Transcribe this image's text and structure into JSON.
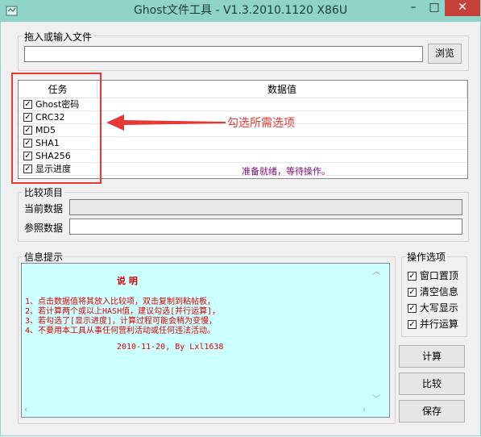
{
  "window": {
    "title": "Ghost文件工具 - V1.3.2010.1120 X86U",
    "min": "–",
    "max": "□",
    "close": "✕"
  },
  "file_input": {
    "label": "拖入或输入文件",
    "value": "",
    "browse_label": "浏览"
  },
  "task_table": {
    "col_task": "任务",
    "col_value": "数据值",
    "rows": [
      {
        "label": "Ghost密码",
        "checked": true
      },
      {
        "label": "CRC32",
        "checked": true
      },
      {
        "label": "MD5",
        "checked": true
      },
      {
        "label": "SHA1",
        "checked": true
      },
      {
        "label": "SHA256",
        "checked": true
      },
      {
        "label": "显示进度",
        "checked": true
      }
    ],
    "status": "准备就绪，等待操作。"
  },
  "annotation": "勾选所需选项",
  "compare": {
    "legend": "比较项目",
    "current_label": "当前数据",
    "reference_label": "参照数据",
    "current_value": "",
    "reference_value": ""
  },
  "info": {
    "legend": "信息提示",
    "heading": "说 明",
    "lines": [
      "1、点击数据值将其放入比较项，双击复制到粘帖板，",
      "2、若计算两个或以上HASH值，建议勾选[并行运算]，",
      "3、若勾选了[显示进度]，计算过程可能会稍为变慢，",
      "4、不要用本工具从事任何营利活动或任何违法活动。"
    ],
    "footer": "2010-11-20, By Lxl1638"
  },
  "options": {
    "legend": "操作选项",
    "items": [
      {
        "label": "窗口置顶",
        "checked": true
      },
      {
        "label": "清空信息",
        "checked": true
      },
      {
        "label": "大写显示",
        "checked": true
      },
      {
        "label": "并行运算",
        "checked": true
      }
    ]
  },
  "actions": {
    "compute": "计算",
    "compare": "比较",
    "save": "保存"
  },
  "colors": {
    "titlebar": "#8fd3c9",
    "close": "#c7413b",
    "info_bg": "#ccffff",
    "info_text": "#e00000",
    "status_text": "#7a0a7a",
    "annotation": "#e53935"
  },
  "icons": {
    "app": "app-icon",
    "check": "checkmark",
    "arrow": "red-left-arrow"
  }
}
